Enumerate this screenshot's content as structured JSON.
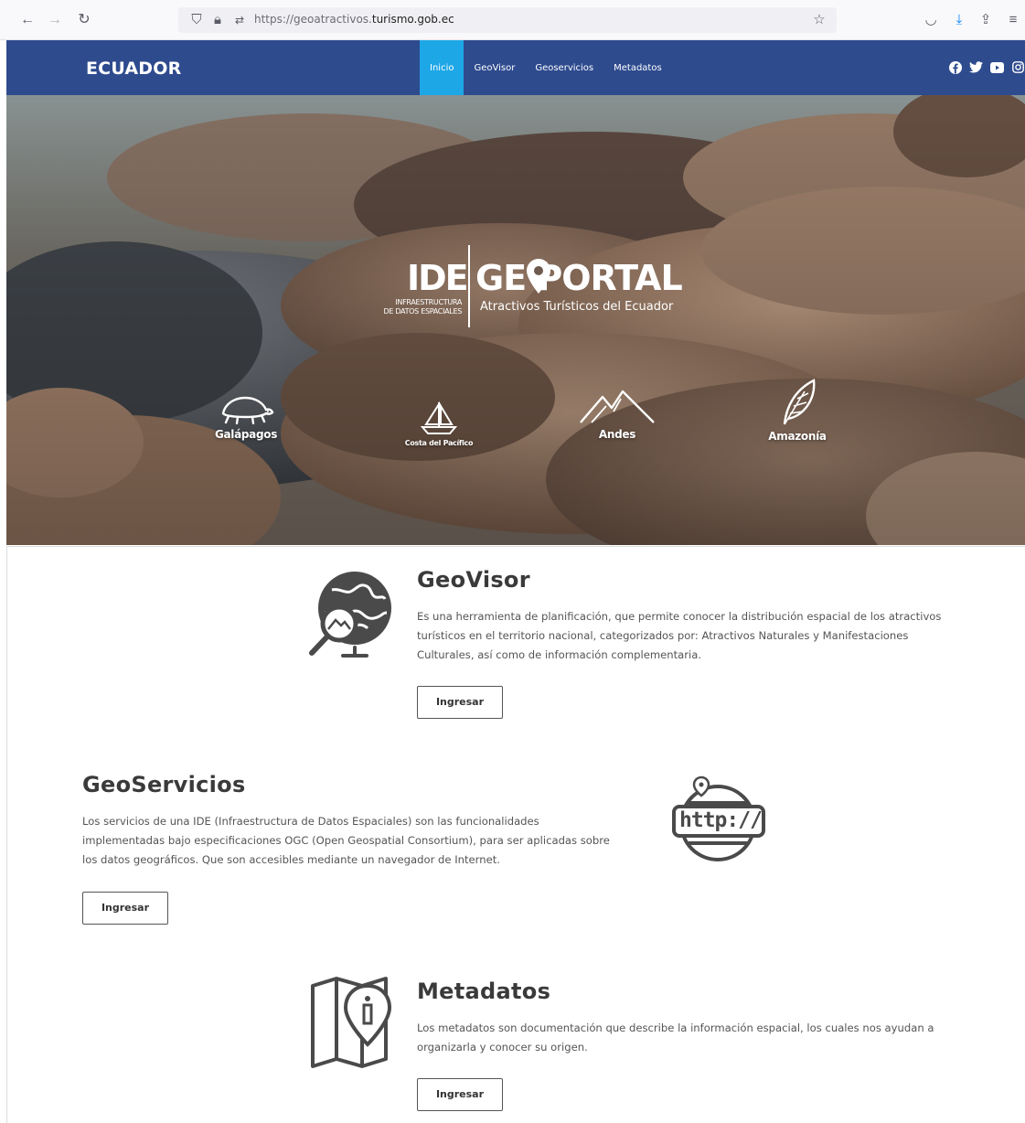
{
  "browser": {
    "url_prefix": "https://geoatractivos.",
    "url_domain": "turismo.gob.ec"
  },
  "header": {
    "brand": "ECUADOR",
    "menu": [
      {
        "label": "Inicio",
        "active": true
      },
      {
        "label": "GeoVisor",
        "active": false
      },
      {
        "label": "Geoservicios",
        "active": false
      },
      {
        "label": "Metadatos",
        "active": false
      }
    ],
    "socials": [
      "facebook-icon",
      "twitter-icon",
      "youtube-icon",
      "instagram-icon"
    ]
  },
  "hero": {
    "logo_ide": "IDE",
    "logo_ide_sub_1": "INFRAESTRUCTURA",
    "logo_ide_sub_2": "DE DATOS ESPACIALES",
    "logo_geo": "GE PORTAL",
    "logo_geo_sub": "Atractivos Turísticos del Ecuador",
    "regions": [
      {
        "label": "Galápagos",
        "icon": "turtle-icon"
      },
      {
        "label": "Costa del Pacífico",
        "icon": "sailboat-icon"
      },
      {
        "label": "Andes",
        "icon": "mountains-icon"
      },
      {
        "label": "Amazonía",
        "icon": "leaf-icon"
      }
    ]
  },
  "sections": {
    "geovisor": {
      "title": "GeoVisor",
      "text_1": "Es una herramienta de planificación, que permite conocer la distribución espacial de los atractivos",
      "text_2": "turísticos en el territorio nacional, categorizados por: Atractivos Naturales y Manifestaciones",
      "text_3": "Culturales, así como de información complementaria.",
      "button": "Ingresar",
      "icon": "globe-magnifier-icon"
    },
    "geoservicios": {
      "title": "GeoServicios",
      "text_1": "Los servicios de una IDE (Infraestructura de Datos Espaciales) son las funcionalidades",
      "text_2": "implementadas bajo especificaciones OGC (Open Geospatial Consortium), para ser aplicadas sobre",
      "text_3": "los datos geográficos. Que son accesibles mediante un navegador de Internet.",
      "button": "Ingresar",
      "icon_text": "http://",
      "icon": "http-globe-icon"
    },
    "metadatos": {
      "title": "Metadatos",
      "text_1": "Los metadatos son documentación que describe la información espacial, los cuales nos ayudan a",
      "text_2": "organizarla y conocer su origen.",
      "button": "Ingresar",
      "icon": "map-info-icon"
    }
  }
}
